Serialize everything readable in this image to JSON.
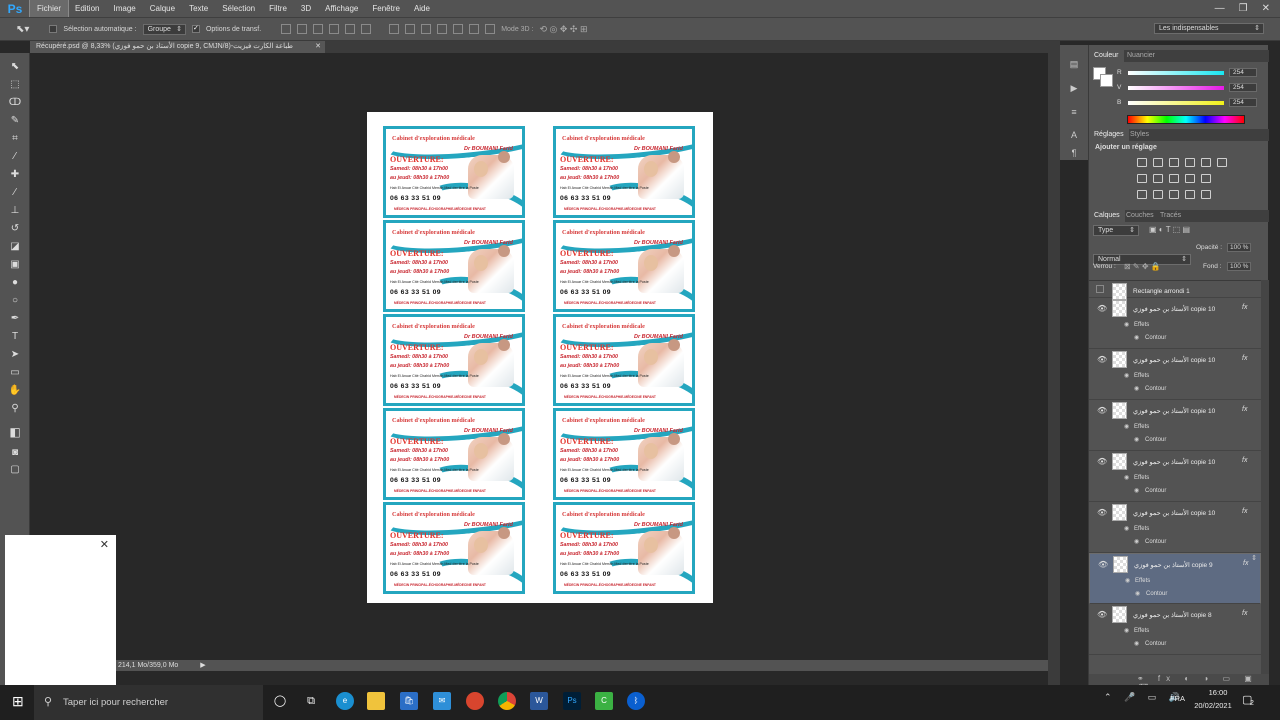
{
  "app": {
    "logo": "Ps"
  },
  "menu": [
    "Fichier",
    "Edition",
    "Image",
    "Calque",
    "Texte",
    "Sélection",
    "Filtre",
    "3D",
    "Affichage",
    "Fenêtre",
    "Aide"
  ],
  "window_controls": [
    "—",
    "❐",
    "✕"
  ],
  "options": {
    "auto_select_label": "Sélection automatique :",
    "auto_select_value": "Groupe",
    "transform_label": "Options de transf.",
    "mode3d_label": "Mode 3D :",
    "workspace": "Les indispensables"
  },
  "document": {
    "tab_title": "Récupéré.psd @ 8,33% (الأستاذ بن حمو فوزي copie 9, CMJN/8)-طباعة الكارت فيزيت"
  },
  "card": {
    "title": "Cabinet d'exploration médicale",
    "doctor": "Dr BOUMANI Farid",
    "opening": "OUVERTURE:",
    "line1": "Samedi: 08h30 à 17h00",
    "line2": "au jeudi: 08h30 à 17h00",
    "address": "Hab El Anuar Cité Chahid Merrah Med derrière la Poste",
    "phone": "06 63 33 51 09",
    "footer": "MÉDECIN PRINCIPAL-ÉCHOGRAPHIE-MÉDECINE ENFANT"
  },
  "status": {
    "doc_size": "214,1 Mo/359,0 Mo"
  },
  "color_panel": {
    "tabs": [
      "Couleur",
      "Nuancier"
    ],
    "channels": [
      {
        "label": "R",
        "value": "254"
      },
      {
        "label": "V",
        "value": "254"
      },
      {
        "label": "B",
        "value": "254"
      }
    ],
    "slider_colors": [
      "#19e6f0",
      "#e619e6",
      "#f0f019"
    ]
  },
  "adjust_panel": {
    "tabs": [
      "Réglages",
      "Styles"
    ],
    "title": "Ajouter un réglage"
  },
  "layers_panel": {
    "tabs": [
      "Calques",
      "Couches",
      "Tracés"
    ],
    "filter": "Type",
    "blend_mode": "Normal",
    "opacity_label": "Opacité :",
    "opacity_value": "100 %",
    "lock_label": "Verrou :",
    "fill_label": "Fond :",
    "fill_value": "100 %",
    "layers": [
      {
        "name": "Rectangle arrondi 1",
        "effects": false,
        "selected": false
      },
      {
        "name": "الأستاذ بن حمو فوزي copie 10",
        "effects": true,
        "selected": false
      },
      {
        "name": "الأستاذ بن حمو فوزي copie 10",
        "effects": true,
        "selected": false
      },
      {
        "name": "الأستاذ بن حمو فوزي copie 10",
        "effects": true,
        "selected": false
      },
      {
        "name": "الأستاذ بن حمو فوزي copie 10",
        "effects": true,
        "selected": false
      },
      {
        "name": "الأستاذ بن حمو فوزي copie 10",
        "effects": true,
        "selected": false
      },
      {
        "name": "الأستاذ بن حمو فوزي copie 9",
        "effects": true,
        "selected": true
      },
      {
        "name": "الأستاذ بن حمو فوزي copie 8",
        "effects": true,
        "selected": false
      }
    ],
    "effects_label": "Effets",
    "stroke_label": "Contour",
    "fx_label": "fx"
  },
  "taskbar": {
    "search_placeholder": "Taper ici pour rechercher",
    "lang": "FRA",
    "time": "16:00",
    "date": "20/02/2021",
    "notif_count": "2"
  }
}
